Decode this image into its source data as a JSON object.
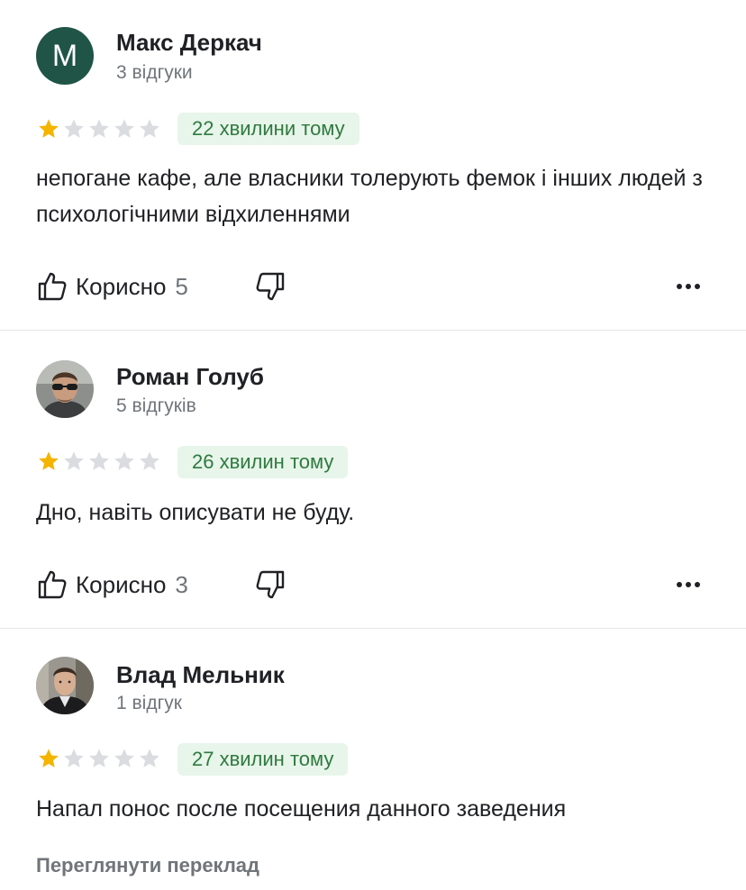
{
  "colors": {
    "avatar_bg": "#1f5446",
    "star_filled": "#f4b400",
    "star_empty": "#dadce0",
    "badge_bg": "#e7f5ea",
    "badge_text": "#2f7a3f",
    "secondary_text": "#70757a"
  },
  "reviews": [
    {
      "avatar_letter": "M",
      "author": "Макс Деркач",
      "review_count": "3 відгуки",
      "rating": 1,
      "max_rating": 5,
      "time": "22 хвилини тому",
      "text": "непогане кафе, але власники толерують фемок і інших людей з психологічними відхиленнями",
      "helpful_label": "Корисно",
      "helpful_count": "5"
    },
    {
      "avatar_image": "man-with-sunglasses-photo",
      "author": "Роман Голуб",
      "review_count": "5 відгуків",
      "rating": 1,
      "max_rating": 5,
      "time": "26 хвилин тому",
      "text": "Дно, навіть описувати не буду.",
      "helpful_label": "Корисно",
      "helpful_count": "3"
    },
    {
      "avatar_image": "man-in-leather-jacket-photo",
      "author": "Влад Мельник",
      "review_count": "1 відгук",
      "rating": 1,
      "max_rating": 5,
      "time": "27 хвилин тому",
      "text": "Напал понос после посещения данного заведения",
      "translate_label": "Переглянути переклад"
    }
  ]
}
